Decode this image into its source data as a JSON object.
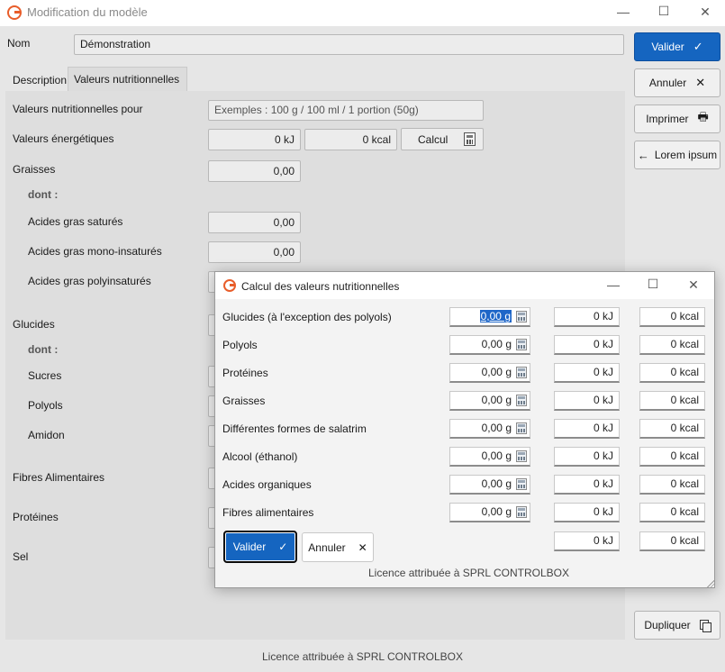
{
  "window": {
    "title": "Modification du modèle",
    "controls": {
      "minimize": "—",
      "maximize": "☐",
      "close": "✕"
    }
  },
  "form": {
    "name_label": "Nom",
    "name_value": "Démonstration"
  },
  "tabs": [
    {
      "label": "Description",
      "active": false
    },
    {
      "label": "Valeurs  nutritionnelles",
      "active": true
    }
  ],
  "nutrition": {
    "for_label": "Valeurs nutritionnelles pour",
    "for_placeholder": "Exemples : 100 g / 100 ml / 1 portion (50g)",
    "energy_label": "Valeurs énergétiques",
    "energy_kj": "0 kJ",
    "energy_kcal": "0 kcal",
    "calc_button": "Calcul",
    "fat_label": "Graisses",
    "fat_value": "0,00",
    "dont_1": "dont :",
    "sat_label": "Acides gras saturés",
    "sat_value": "0,00",
    "mono_label": "Acides gras mono-insaturés",
    "mono_value": "0,00",
    "poly_label": "Acides gras polyinsaturés",
    "carbs_label": "Glucides",
    "dont_2": "dont :",
    "sugars_label": "Sucres",
    "polyols_label": "Polyols",
    "starch_label": "Amidon",
    "fiber_label": "Fibres Alimentaires",
    "protein_label": "Protéines",
    "salt_label": "Sel"
  },
  "side_buttons": {
    "validate": "Valider",
    "cancel": "Annuler",
    "print": "Imprimer",
    "lorem": "Lorem  ipsum",
    "duplicate": "Dupliquer"
  },
  "footer": {
    "license": "Licence attribuée à SPRL CONTROLBOX"
  },
  "dialog": {
    "title": "Calcul des valeurs nutritionnelles",
    "rows": [
      {
        "label": "Glucides (à l'exception des polyols)",
        "grams": "0,00 g",
        "kj": "0 kJ",
        "kcal": "0 kcal"
      },
      {
        "label": "Polyols",
        "grams": "0,00 g",
        "kj": "0 kJ",
        "kcal": "0 kcal"
      },
      {
        "label": "Protéines",
        "grams": "0,00 g",
        "kj": "0 kJ",
        "kcal": "0 kcal"
      },
      {
        "label": "Graisses",
        "grams": "0,00 g",
        "kj": "0 kJ",
        "kcal": "0 kcal"
      },
      {
        "label": "Différentes formes de salatrim",
        "grams": "0,00 g",
        "kj": "0 kJ",
        "kcal": "0 kcal"
      },
      {
        "label": "Alcool (éthanol)",
        "grams": "0,00 g",
        "kj": "0 kJ",
        "kcal": "0 kcal"
      },
      {
        "label": "Acides organiques",
        "grams": "0,00 g",
        "kj": "0 kJ",
        "kcal": "0 kcal"
      },
      {
        "label": "Fibres alimentaires",
        "grams": "0,00 g",
        "kj": "0 kJ",
        "kcal": "0 kcal"
      }
    ],
    "total_kj": "0 kJ",
    "total_kcal": "0 kcal",
    "validate": "Valider",
    "cancel": "Annuler",
    "license": "Licence attribuée à SPRL CONTROLBOX"
  },
  "colors": {
    "primary": "#1565c0",
    "logo": "#e85d2a"
  }
}
